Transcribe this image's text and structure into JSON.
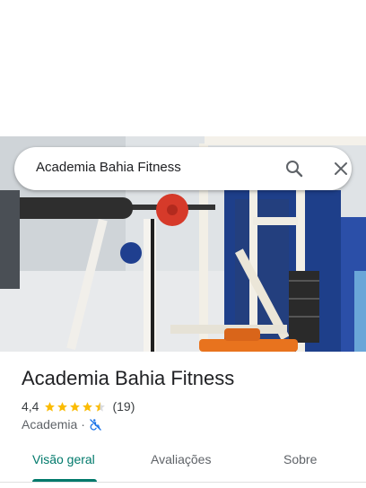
{
  "search": {
    "query": "Academia Bahia Fitness",
    "search_icon": "search-icon",
    "close_icon": "close-icon"
  },
  "hero_image": {
    "icon": "gym-photo"
  },
  "place": {
    "title": "Academia Bahia Fitness",
    "rating": "4,4",
    "rating_stars_value": 4.4,
    "review_count": "(19)",
    "category": "Academia",
    "separator": "·",
    "accessibility_icon": "wheelchair-not-accessible-icon"
  },
  "tabs": [
    {
      "label": "Visão geral",
      "active": true
    },
    {
      "label": "Avaliações",
      "active": false
    },
    {
      "label": "Sobre",
      "active": false
    }
  ],
  "colors": {
    "accent": "#00796b",
    "star": "#fbbc04",
    "access_icon": "#1a73e8"
  }
}
